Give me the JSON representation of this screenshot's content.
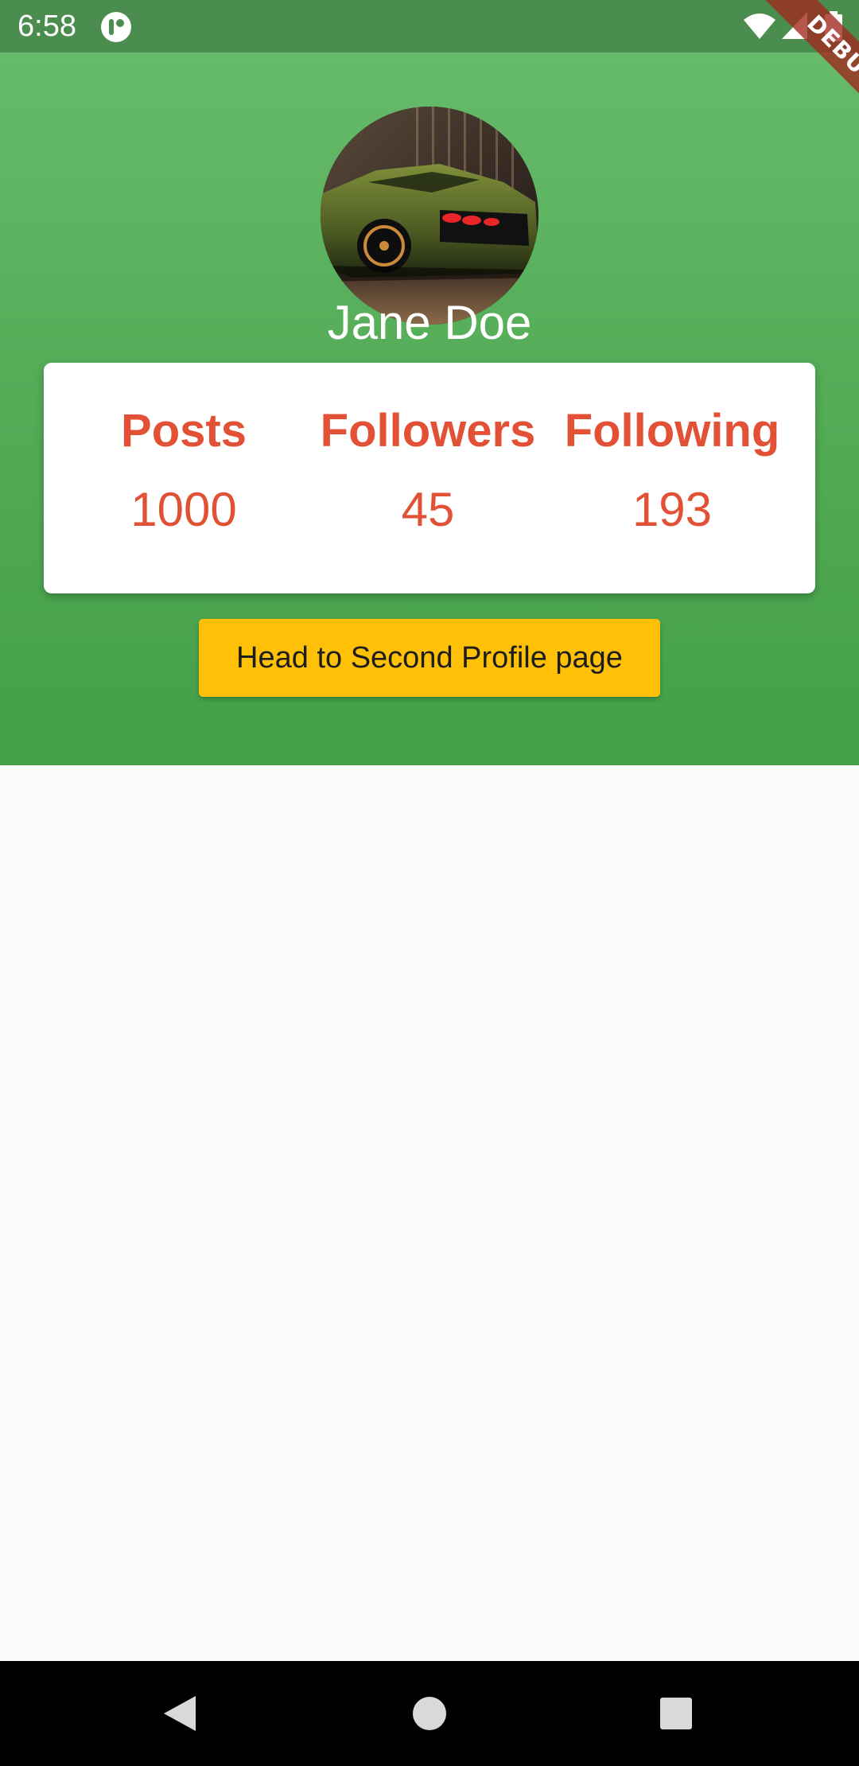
{
  "status_bar": {
    "time": "6:58",
    "app_icon": "app-notification-icon",
    "wifi_icon": "wifi-icon",
    "signal_icon": "cell-signal-icon",
    "battery_icon": "battery-icon"
  },
  "debug_banner": {
    "label": "DEBUG"
  },
  "profile": {
    "avatar_icon": "sports-car-photo",
    "name": "Jane Doe"
  },
  "stats": [
    {
      "label": "Posts",
      "value": "1000"
    },
    {
      "label": "Followers",
      "value": "45"
    },
    {
      "label": "Following",
      "value": "193"
    }
  ],
  "actions": {
    "second_profile_label": "Head to Second Profile page"
  },
  "nav_bar": {
    "back_icon": "back-triangle-icon",
    "home_icon": "home-circle-icon",
    "recents_icon": "recents-square-icon"
  },
  "colors": {
    "header_gradient_top": "#66bb6a",
    "header_gradient_bottom": "#43a047",
    "status_bar": "#4b8c4f",
    "stat_text": "#e25136",
    "button": "#ffc107",
    "body_background": "#fafafa",
    "nav_bar": "#000000"
  }
}
